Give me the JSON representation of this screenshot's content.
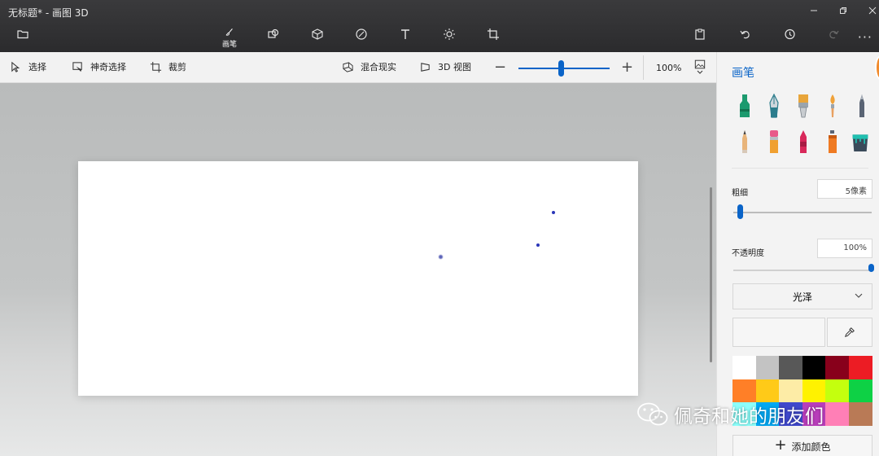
{
  "window": {
    "title": "无标题* - 画图 3D"
  },
  "top_toolbar": {
    "brushes_label": "画笔"
  },
  "sub_toolbar": {
    "select_label": "选择",
    "magic_select_label": "神奇选择",
    "crop_label": "裁剪",
    "mixed_reality_label": "混合现实",
    "view3d_label": "3D 视图",
    "zoom_minus": "−",
    "zoom_plus": "+",
    "zoom_value": "100%",
    "zoom_level": 0.47
  },
  "panel": {
    "title": "画笔",
    "brushes": [
      {
        "name": "marker",
        "color": "#1c9a6e"
      },
      {
        "name": "calligraphy-pen",
        "color": "#2b7c8c"
      },
      {
        "name": "oil-brush",
        "color": "#e8a53a"
      },
      {
        "name": "watercolor",
        "color": "#f0a23a"
      },
      {
        "name": "pixel-pen",
        "color": "#5a6474"
      },
      {
        "name": "pencil",
        "color": "#e8b47a"
      },
      {
        "name": "eraser",
        "color": "#e85a8a"
      },
      {
        "name": "crayon",
        "color": "#d8285a"
      },
      {
        "name": "spray-can",
        "color": "#ef7a22"
      },
      {
        "name": "fill",
        "color": "#3a4a5a"
      }
    ],
    "thickness_label": "粗细",
    "thickness_value": "5像素",
    "thickness_level": 0.05,
    "opacity_label": "不透明度",
    "opacity_value": "100%",
    "opacity_level": 1.0,
    "finish_value": "光泽",
    "palette": [
      "#ffffff",
      "#c3c3c3",
      "#585858",
      "#000000",
      "#88001b",
      "#ec1c24",
      "#ff7f27",
      "#ffca18",
      "#fdeca6",
      "#fff200",
      "#c4ff0e",
      "#0ed145",
      "#8cfffb",
      "#00a8f3",
      "#3f48cc",
      "#b83dba",
      "#ff7fb6",
      "#b97a56"
    ],
    "add_color_label": "添加颜色"
  },
  "watermark": {
    "text": "佩奇和她的朋友们"
  },
  "colors": {
    "accent": "#0a64c8"
  }
}
